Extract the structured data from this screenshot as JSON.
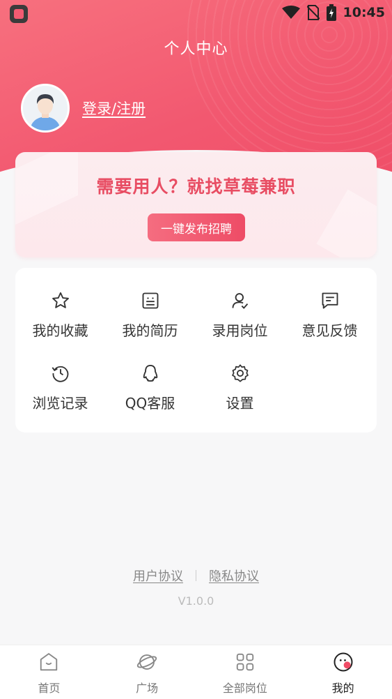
{
  "status_bar": {
    "time": "10:45"
  },
  "header": {
    "title": "个人中心"
  },
  "profile": {
    "login_label": "登录/注册"
  },
  "promo": {
    "title": "需要用人？就找草莓兼职",
    "button_label": "一键发布招聘"
  },
  "menu": {
    "items": [
      {
        "label": "我的收藏",
        "icon": "star-icon"
      },
      {
        "label": "我的简历",
        "icon": "resume-icon"
      },
      {
        "label": "录用岗位",
        "icon": "user-check-icon"
      },
      {
        "label": "意见反馈",
        "icon": "feedback-icon"
      },
      {
        "label": "浏览记录",
        "icon": "history-icon"
      },
      {
        "label": "QQ客服",
        "icon": "qq-icon"
      },
      {
        "label": "设置",
        "icon": "gear-icon"
      }
    ]
  },
  "footer": {
    "user_agreement": "用户协议",
    "privacy_agreement": "隐私协议",
    "version": "V1.0.0"
  },
  "tabbar": {
    "tabs": [
      {
        "label": "首页",
        "icon": "home-icon",
        "active": false
      },
      {
        "label": "广场",
        "icon": "planet-icon",
        "active": false
      },
      {
        "label": "全部岗位",
        "icon": "grid-icon",
        "active": false
      },
      {
        "label": "我的",
        "icon": "profile-face-icon",
        "active": true
      }
    ]
  },
  "colors": {
    "accent": "#ef4c66",
    "promo_text": "#e84d63"
  }
}
